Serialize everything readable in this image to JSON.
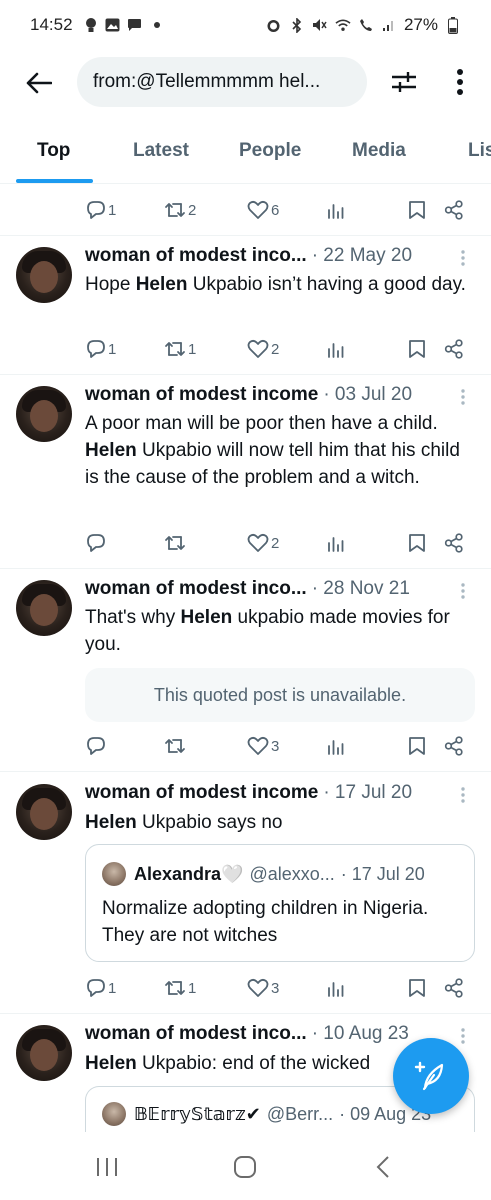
{
  "status_bar": {
    "time": "14:52",
    "battery": "27%"
  },
  "search": {
    "query": "from:@Tellemmmmm hel..."
  },
  "tabs": [
    {
      "label": "Top"
    },
    {
      "label": "Latest"
    },
    {
      "label": "People"
    },
    {
      "label": "Media"
    },
    {
      "label": "Lis"
    }
  ],
  "first_actions": {
    "replies": "1",
    "reposts": "2",
    "likes": "6"
  },
  "posts": [
    {
      "name": "woman of modest inco...",
      "date": "· 22 May 20",
      "text_bold": "Helen",
      "text_before": "Hope ",
      "text_after": " Ukpabio isn’t having a good day.",
      "replies": "1",
      "reposts": "1",
      "likes": "2"
    },
    {
      "name": "woman of modest income",
      "date": "· 03 Jul 20",
      "text_before": "A poor man will be poor then have a child. ",
      "text_bold": "Helen",
      "text_after": " Ukpabio will now tell him that his child is the cause of the problem and a witch.",
      "replies": "",
      "reposts": "",
      "likes": "2"
    },
    {
      "name": "woman of modest inco...",
      "date": "· 28 Nov 21",
      "text_before": "That's why ",
      "text_bold": "Helen",
      "text_after": " ukpabio made movies for you.",
      "quote_unavailable": "This quoted post is unavailable.",
      "replies": "",
      "reposts": "",
      "likes": "3"
    },
    {
      "name": "woman of modest income",
      "date": "· 17 Jul 20",
      "text_before": "",
      "text_bold": "Helen",
      "text_after": " Ukpabio says no",
      "quote": {
        "name": "Alexandra🤍",
        "handle": "@alexxo...",
        "date": "· 17 Jul 20",
        "text": "Normalize adopting children in Nigeria. They are not witches"
      },
      "replies": "1",
      "reposts": "1",
      "likes": "3"
    },
    {
      "name": "woman of modest inco...",
      "date": "· 10 Aug 23",
      "text_before": "",
      "text_bold": "Helen",
      "text_after": " Ukpabio: end of the wicked",
      "quote": {
        "name": "𝔹𝔼𝕣𝕣𝕪𝕊𝕥𝕒𝕣𝕫✔",
        "handle": "@Berr...",
        "date": "· 09 Aug 23"
      }
    }
  ],
  "colors": {
    "accent": "#1d9bf0",
    "text_primary": "#0f1419",
    "text_secondary": "#536471",
    "divider": "#eff3f4"
  },
  "icons": [
    "back-arrow-icon",
    "filter-sliders-icon",
    "more-vertical-icon",
    "reply-icon",
    "repost-icon",
    "like-icon",
    "views-icon",
    "bookmark-icon",
    "share-icon",
    "compose-icon"
  ]
}
